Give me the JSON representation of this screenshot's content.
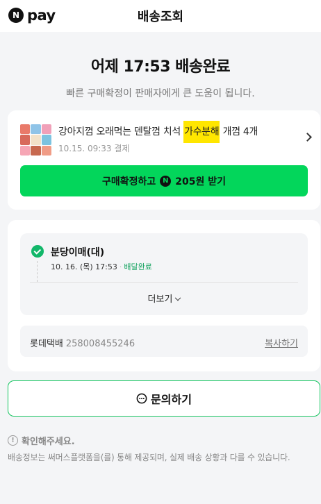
{
  "header": {
    "logo_badge": "N",
    "logo_text": "pay",
    "title": "배송조회"
  },
  "hero": {
    "title": "어제 17:53 배송완료",
    "subtitle": "빠른 구매확정이 판매자에게 큰 도움이 됩니다."
  },
  "product": {
    "name_before": "강아지껌 오래먹는 덴탈껌 치석 ",
    "name_highlight": "가수분해",
    "name_after": " 개껌 4개",
    "order_date": "10.15. 09:33 결제",
    "confirm_label_before": "구매확정하고",
    "point_badge": "N",
    "confirm_label_after": "205원 받기"
  },
  "tracking": {
    "place": "분당이매(대)",
    "time": "10. 16. (목) 17:53",
    "separator": "·",
    "status": "배달완료",
    "more_label": "더보기",
    "courier_name": "롯데택배",
    "tracking_number": "258008455246",
    "copy_label": "복사하기"
  },
  "inquiry": {
    "label": "문의하기"
  },
  "notice": {
    "icon": "!",
    "title": "확인해주세요.",
    "body": "배송정보는 써머스플랫폼을(를) 통해 제공되며, 실제 배송 상황과 다를 수 있습니다."
  },
  "colors": {
    "green": "#03d65b",
    "status_green": "#12a25e",
    "highlight": "#ffe600"
  }
}
